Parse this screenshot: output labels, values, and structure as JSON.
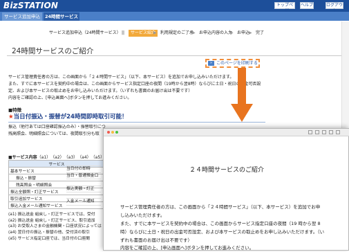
{
  "header": {
    "logo": "BizSTATION",
    "links": [
      "トップページ",
      "ヘルプ",
      "ログアウト"
    ]
  },
  "tabs": [
    {
      "label": "サービス追加申込",
      "active": false
    },
    {
      "label": "24時間サービス",
      "active": true
    }
  ],
  "steps": {
    "title": "サービス追加申込（24時間サービス）",
    "separator": "||",
    "items": [
      "サービス紹介",
      "利用規定のご了承",
      "お申込内容の入力",
      "お申込",
      "完了"
    ],
    "arrow": "▶"
  },
  "page_title": "24時間サービスのご紹介",
  "print_link": "このページを印刷する",
  "intro": [
    "サービス管理責任者の方は、この画面から「２４時間サービス」（以下、本サービス）を追加でお申し込みいただけます。",
    "また、すでに本サービスを契約中の場合は、この画面からサービス指定口座の夜間（19時から翌8時）ならびに土日・祝日の出金可否設",
    "定、および本サービスの取止めをお申し込みいただけます。（いずれも書面のお届け出は不要です）",
    "内容をご確認の上、[申込画面へ]ボタンを押してお進みください。"
  ],
  "features": {
    "heading": "■特徴",
    "highlight_star": "★",
    "highlight": "当日付振込・振替が24時間即時取引可能！",
    "desc": [
      "振込（他行あては口座確認振込のみ）・振替取引につ",
      "残高照会、明細照会については、夜間取引分も取"
    ]
  },
  "service_table": {
    "heading": "■サービス内容",
    "refs": "（a1）　（a2）　（a3）　（a4）　（a5）",
    "col_header": "サービス",
    "rows": [
      {
        "name": "基本サービス",
        "indent": false
      },
      {
        "name": "振込・振替",
        "indent": true
      },
      {
        "name": "残高照会・明細照会",
        "indent": true
      },
      {
        "name": "振込全額照・訂正サービス",
        "indent": false
      },
      {
        "name": "取引追加サービス",
        "indent": false
      },
      {
        "name": "振込入金メール通知サービス",
        "indent": false
      }
    ],
    "right_peek": [
      "",
      "当日付の即時",
      "当日・普通預金口",
      "",
      "振込実額・訂正",
      "",
      "入金メール通知"
    ]
  },
  "notes": [
    "(a1)  振込送金 組戻し・訂正サービスでは、受付",
    "(a2)  振込送金 組戻し・訂正サービス、取引追加",
    "(a3)  お受取人さまの金融機関・口座状況によっては",
    "(a4)  翌日付の振込・振替の他、受付済の取引",
    "(a5)  サービス指定口座では、当日付の口座間"
  ],
  "preview": {
    "title": "２４時間サービスのご紹介",
    "lines": [
      "サービス管理責任者の方は、この画面から「２４時間サービス」（以下、本サービス）を追加でお申",
      "し込みいただけます。",
      "また、すでに本サービスを契約中の場合は、この画面からサービス指定口座の夜間（19 時から翌 8",
      "時）ならびに土日・祝日の出金可否設定、および本サービスの取止めをお申し込みいただけます。（い",
      "ずれも書面のお届け出は不要です）",
      "内容をご確認の上、[申込画面へ]ボタンを押してお進みください。"
    ]
  },
  "colors": {
    "header": "#1d4f9a",
    "tab_bar": "#4a7fc8",
    "accent": "#e8741f",
    "step_active": "#f2a93b",
    "highlight_text": "#1d3f8a",
    "star": "#e03a1d"
  }
}
